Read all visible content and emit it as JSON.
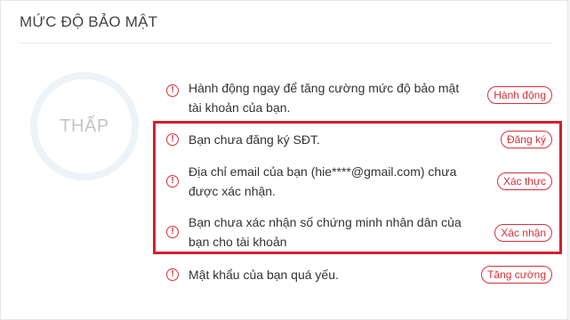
{
  "section": {
    "title": "MỨC ĐỘ BẢO MẬT",
    "level_label": "THẤP"
  },
  "colors": {
    "accent": "#d6313b",
    "highlight_box": "#d3202e",
    "gauge_ring": "#edf3f6"
  },
  "icons": {
    "warning": "exclamation-circle-icon"
  },
  "items": [
    {
      "text": "Hành động ngay để tăng cường mức độ bảo mật tài khoản của bạn.",
      "button": "Hành động"
    },
    {
      "text": "Bạn chưa đăng ký SĐT.",
      "button": "Đăng ký"
    },
    {
      "text": "Địa chỉ email của bạn (hie****@gmail.com) chưa được xác nhận.",
      "button": "Xác thực"
    },
    {
      "text": "Bạn chưa xác nhận số chứng minh nhân dân của bạn cho tài khoản",
      "button": "Xác nhận"
    },
    {
      "text": "Mật khẩu của bạn quá yếu.",
      "button": "Tăng cường"
    }
  ]
}
